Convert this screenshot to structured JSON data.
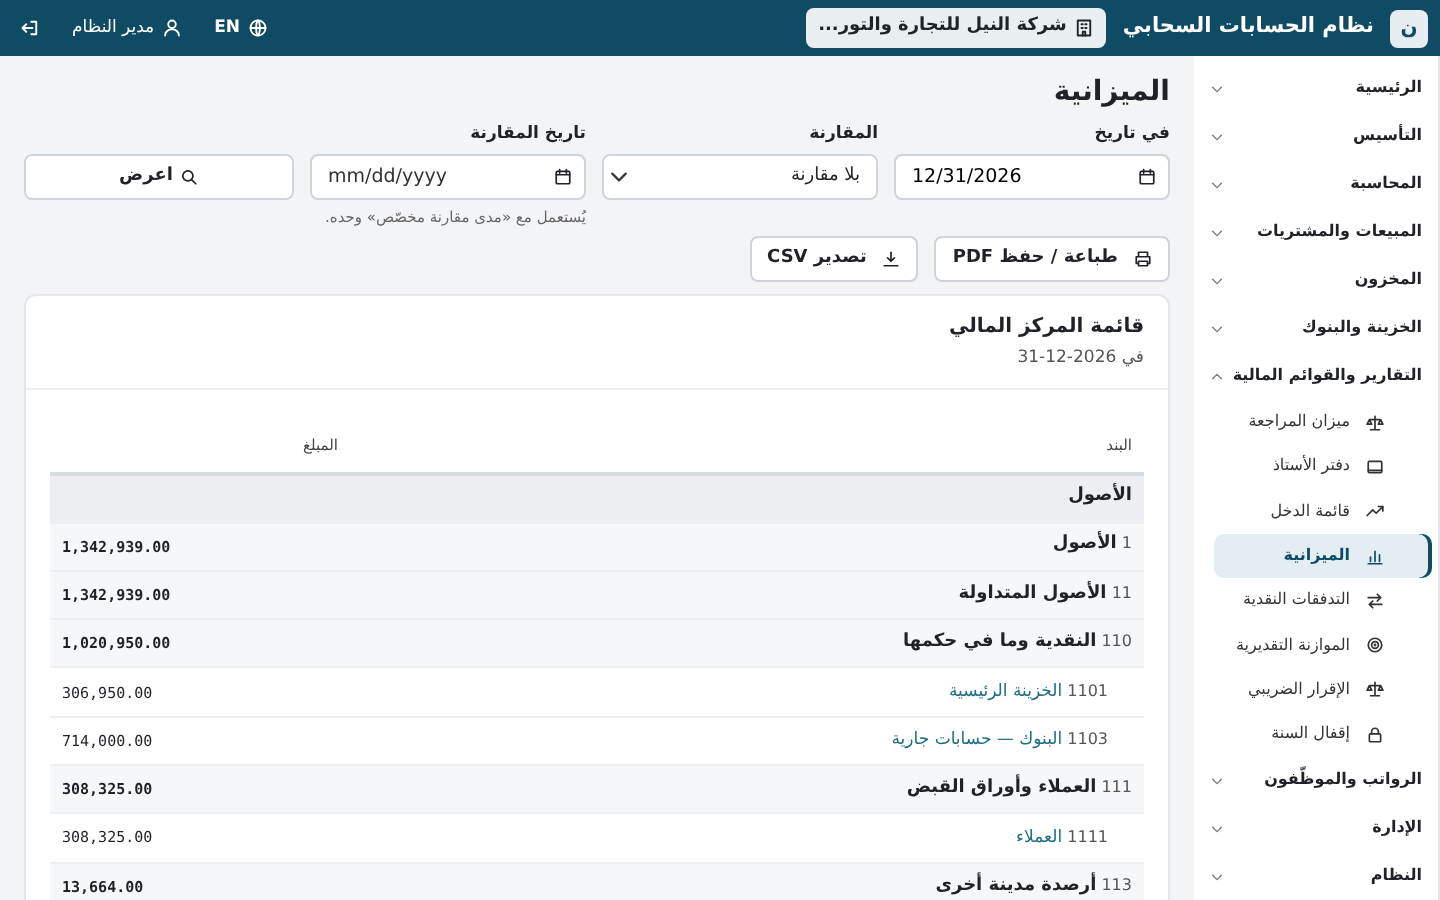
{
  "topbar": {
    "logo": "ن",
    "app_title": "نظام الحسابات السحابي",
    "company": "شركة النيل للتجارة والتور...",
    "language": "EN",
    "user": "مدير النظام"
  },
  "sidebar": {
    "items": [
      {
        "label": "الرئيسية",
        "expanded": false
      },
      {
        "label": "التأسيس",
        "expanded": false
      },
      {
        "label": "المحاسبة",
        "expanded": false
      },
      {
        "label": "المبيعات والمشتريات",
        "expanded": false
      },
      {
        "label": "المخزون",
        "expanded": false
      },
      {
        "label": "الخزينة والبنوك",
        "expanded": false
      },
      {
        "label": "التقارير والقوائم المالية",
        "expanded": true,
        "children": [
          {
            "label": "ميزان المراجعة",
            "kind": "scale",
            "selected": false
          },
          {
            "label": "دفتر الأستاذ",
            "kind": "book",
            "selected": false
          },
          {
            "label": "قائمة الدخل",
            "kind": "trend",
            "selected": false
          },
          {
            "label": "الميزانية",
            "kind": "bars",
            "selected": true
          },
          {
            "label": "التدفقات النقدية",
            "kind": "swap",
            "selected": false
          },
          {
            "label": "الموازنة التقديرية",
            "kind": "target",
            "selected": false
          },
          {
            "label": "الإقرار الضريبي",
            "kind": "scale",
            "selected": false
          },
          {
            "label": "إقفال السنة",
            "kind": "lock",
            "selected": false
          }
        ]
      },
      {
        "label": "الرواتب والموظّفون",
        "expanded": false
      },
      {
        "label": "الإدارة",
        "expanded": false
      },
      {
        "label": "النظام",
        "expanded": false
      }
    ]
  },
  "page": {
    "title": "الميزانية",
    "filters": [
      {
        "kind": "date",
        "label": "في تاريخ",
        "value": "12/31/2026"
      },
      {
        "kind": "select",
        "label": "المقارنة",
        "value": "بلا مقارنة"
      },
      {
        "kind": "date",
        "label": "تاريخ المقارنة",
        "placeholder": "mm/dd/yyyy",
        "help": "يُستعمل مع «مدى مقارنة مخصّص» وحده."
      }
    ],
    "show_button": "اعرض",
    "actions": [
      {
        "kind": "print",
        "label": "طباعة / حفظ PDF"
      },
      {
        "kind": "download",
        "label": "تصدير CSV"
      }
    ]
  },
  "report": {
    "title": "قائمة المركز المالي",
    "subtitle": "في 2026-12-31",
    "columns": [
      "البند",
      "المبلغ"
    ],
    "rows": [
      {
        "kind": "section",
        "label": "الأصول"
      },
      {
        "kind": "group",
        "code": "1",
        "label": "الأصول",
        "amount": "1,342,939.00"
      },
      {
        "kind": "group",
        "code": "11",
        "label": "الأصول المتداولة",
        "amount": "1,342,939.00"
      },
      {
        "kind": "group",
        "code": "110",
        "label": "النقدية وما في حكمها",
        "amount": "1,020,950.00"
      },
      {
        "kind": "account",
        "code": "1101",
        "label": "الخزينة الرئيسية",
        "amount": "306,950.00"
      },
      {
        "kind": "account",
        "code": "1103",
        "label": "البنوك — حسابات جارية",
        "amount": "714,000.00"
      },
      {
        "kind": "group",
        "code": "111",
        "label": "العملاء وأوراق القبض",
        "amount": "308,325.00"
      },
      {
        "kind": "account",
        "code": "1111",
        "label": "العملاء",
        "amount": "308,325.00"
      },
      {
        "kind": "group",
        "code": "113",
        "label": "أرصدة مدينة أخرى",
        "amount": "13,664.00"
      }
    ]
  }
}
